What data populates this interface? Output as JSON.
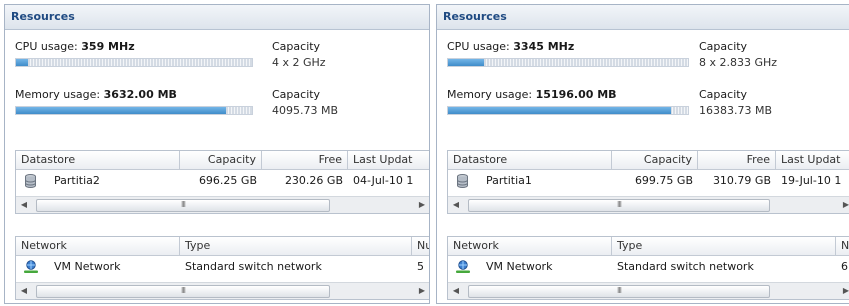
{
  "panels": [
    {
      "title": "Resources",
      "cpu": {
        "label": "CPU usage:",
        "value": "359 MHz",
        "fraction": 0.05,
        "capacity_label": "Capacity",
        "capacity_value": "4 x 2 GHz"
      },
      "memory": {
        "label": "Memory usage:",
        "value": "3632.00 MB",
        "fraction": 0.89,
        "capacity_label": "Capacity",
        "capacity_value": "4095.73 MB"
      },
      "datastore": {
        "columns": [
          "Datastore",
          "Capacity",
          "Free",
          "Last Updat"
        ],
        "rows": [
          {
            "name": "Partitia2",
            "capacity": "696.25 GB",
            "free": "230.26 GB",
            "updated": "04-Jul-10 1"
          }
        ],
        "scroll_grip": "III"
      },
      "network": {
        "columns": [
          "Network",
          "Type",
          "Nu"
        ],
        "rows": [
          {
            "name": "VM Network",
            "type": "Standard switch network",
            "num": "5"
          }
        ],
        "scroll_grip": "III"
      }
    },
    {
      "title": "Resources",
      "cpu": {
        "label": "CPU usage:",
        "value": "3345 MHz",
        "fraction": 0.15,
        "capacity_label": "Capacity",
        "capacity_value": "8 x 2.833 GHz"
      },
      "memory": {
        "label": "Memory usage:",
        "value": "15196.00 MB",
        "fraction": 0.93,
        "capacity_label": "Capacity",
        "capacity_value": "16383.73 MB"
      },
      "datastore": {
        "columns": [
          "Datastore",
          "Capacity",
          "Free",
          "Last Updat"
        ],
        "rows": [
          {
            "name": "Partitia1",
            "capacity": "699.75 GB",
            "free": "310.79 GB",
            "updated": "19-Jul-10 1"
          }
        ],
        "scroll_grip": "III"
      },
      "network": {
        "columns": [
          "Network",
          "Type",
          "Nu"
        ],
        "rows": [
          {
            "name": "VM Network",
            "type": "Standard switch network",
            "num": "6"
          }
        ],
        "scroll_grip": "III"
      }
    }
  ],
  "icons": {
    "datastore": "database-icon",
    "network": "network-icon",
    "scroll_left": "arrow-left-icon",
    "scroll_right": "arrow-right-icon"
  },
  "colors": {
    "title_text": "#1f4a82",
    "bar_fill": "#4a98d4"
  }
}
